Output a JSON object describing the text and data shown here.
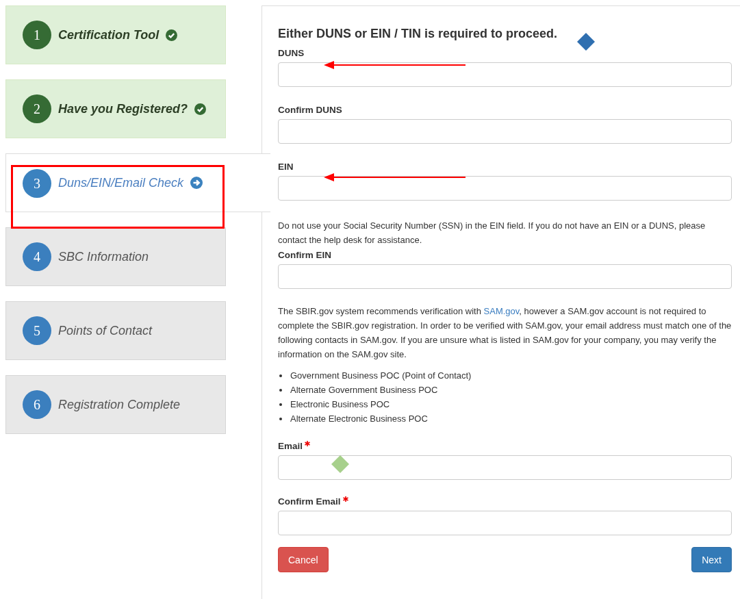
{
  "steps": [
    {
      "number": "1",
      "label": "Certification Tool",
      "completed": true,
      "selected": false
    },
    {
      "number": "2",
      "label": "Have you Registered?",
      "completed": true,
      "selected": false
    },
    {
      "number": "3",
      "label": "Duns/EIN/Email Check",
      "completed": false,
      "selected": true
    },
    {
      "number": "4",
      "label": "SBC Information",
      "completed": false,
      "selected": false
    },
    {
      "number": "5",
      "label": "Points of Contact",
      "completed": false,
      "selected": false
    },
    {
      "number": "6",
      "label": "Registration Complete",
      "completed": false,
      "selected": false
    }
  ],
  "form": {
    "heading": "Either DUNS or EIN / TIN is required to proceed.",
    "fields_top": [
      {
        "label": "DUNS",
        "required": false
      },
      {
        "label": "Confirm DUNS",
        "required": false
      },
      {
        "label": "EIN",
        "required": false
      }
    ],
    "ssn_note": "Do not use your Social Security Number (SSN) in the EIN field. If you do not have an EIN or a DUNS, please contact the help desk for assistance.",
    "fields_mid": [
      {
        "label": "Confirm EIN",
        "required": false
      }
    ],
    "info": {
      "before": "The SBIR.gov system recommends verification with ",
      "link": "SAM.gov",
      "after": ", however a SAM.gov account is not required to complete the SBIR.gov registration. In order to be verified with SAM.gov, your email address must match one of the following contacts in SAM.gov. If you are unsure what is listed in SAM.gov for your company, you may verify the information on the SAM.gov site."
    },
    "contacts": [
      "Government Business POC (Point of Contact)",
      "Alternate Government Business POC",
      "Electronic Business POC",
      "Alternate Electronic Business POC"
    ],
    "fields_bottom": [
      {
        "label": "Email",
        "required": true
      },
      {
        "label": "Confirm Email",
        "required": true
      }
    ],
    "buttons": {
      "cancel": "Cancel",
      "next": "Next"
    }
  }
}
